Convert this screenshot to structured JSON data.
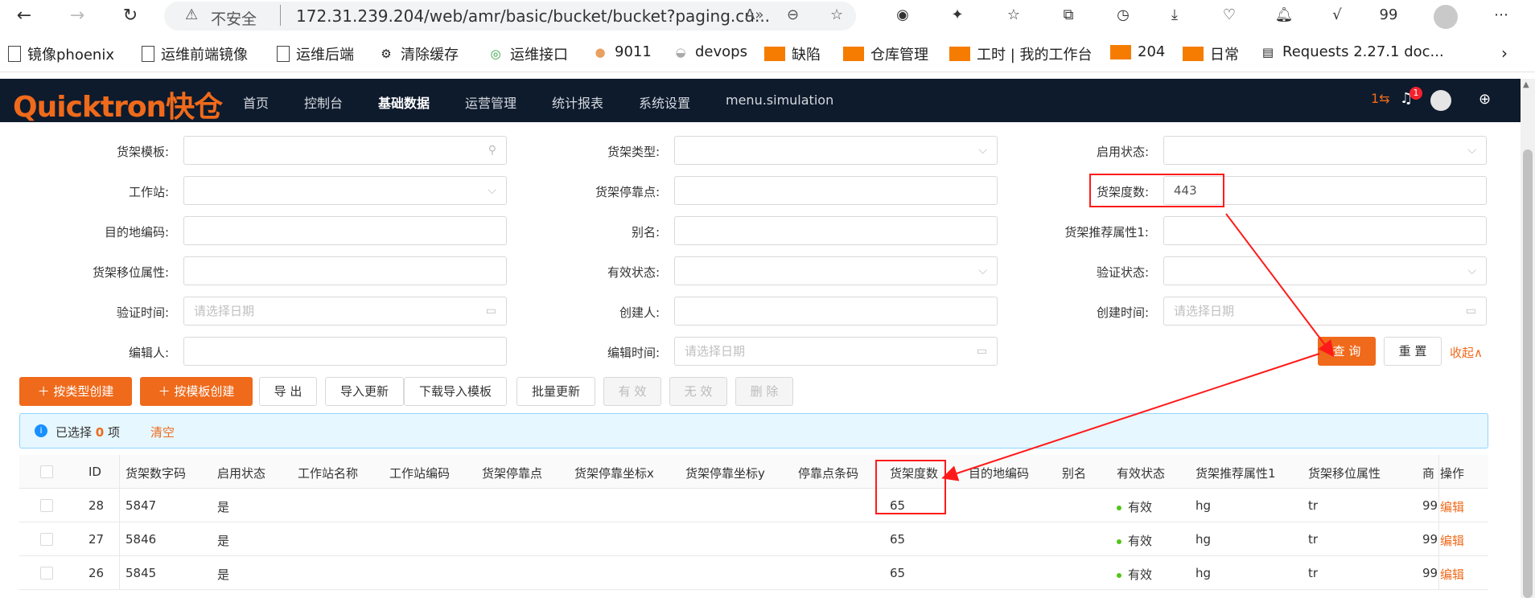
{
  "browser": {
    "insecure_label": "不安全",
    "url": "172.31.239.204/web/amr/basic/bucket/bucket?paging.cu...",
    "toolbar_extra": "99"
  },
  "bookmarks": [
    {
      "label": "镜像phoenix",
      "icon": "file-icon"
    },
    {
      "label": "运维前端镜像",
      "icon": "file-icon"
    },
    {
      "label": "运维后端",
      "icon": "file-icon"
    },
    {
      "label": "清除缓存",
      "icon": "gear-icon"
    },
    {
      "label": "运维接口",
      "icon": "api-icon"
    },
    {
      "label": "9011",
      "icon": "site-icon"
    },
    {
      "label": "devops",
      "icon": "site-icon"
    },
    {
      "label": "缺陷",
      "icon": "orange-icon"
    },
    {
      "label": "仓库管理",
      "icon": "orange-icon"
    },
    {
      "label": "工时 | 我的工作台",
      "icon": "orange-icon"
    },
    {
      "label": "204",
      "icon": "orange-icon"
    },
    {
      "label": "日常",
      "icon": "orange-icon"
    },
    {
      "label": "Requests 2.27.1 doc...",
      "icon": "doc-icon"
    }
  ],
  "app": {
    "logo": "Quicktron快仓",
    "menu": [
      "首页",
      "控制台",
      "基础数据",
      "运营管理",
      "统计报表",
      "系统设置",
      "menu.simulation"
    ],
    "active_menu": "基础数据",
    "header_count": "1⇆",
    "notification_badge": "1"
  },
  "form": {
    "bucket_template": {
      "label": "货架模板:",
      "value": ""
    },
    "bucket_type": {
      "label": "货架类型:",
      "value": ""
    },
    "enable_status": {
      "label": "启用状态:",
      "value": ""
    },
    "workstation": {
      "label": "工作站:",
      "value": ""
    },
    "stop_point": {
      "label": "货架停靠点:",
      "value": ""
    },
    "bucket_degree": {
      "label": "货架度数:",
      "value": "443"
    },
    "dest_code": {
      "label": "目的地编码:",
      "value": ""
    },
    "alias": {
      "label": "别名:",
      "value": ""
    },
    "recommend_attr": {
      "label": "货架推荐属性1:",
      "value": ""
    },
    "move_attr": {
      "label": "货架移位属性:",
      "value": ""
    },
    "valid_status": {
      "label": "有效状态:",
      "value": ""
    },
    "verify_status": {
      "label": "验证状态:",
      "value": ""
    },
    "verify_time": {
      "label": "验证时间:",
      "placeholder": "请选择日期"
    },
    "creator": {
      "label": "创建人:",
      "value": ""
    },
    "create_time": {
      "label": "创建时间:",
      "placeholder": "请选择日期"
    },
    "editor": {
      "label": "编辑人:",
      "value": ""
    },
    "edit_time": {
      "label": "编辑时间:",
      "placeholder": "请选择日期"
    },
    "query_button": "查 询",
    "reset_button": "重 置",
    "collapse_link": "收起∧"
  },
  "actions": {
    "create_by_type": "按类型创建",
    "create_by_template": "按模板创建",
    "export": "导 出",
    "import_update": "导入更新",
    "download_template": "下载导入模板",
    "batch_update": "批量更新",
    "valid": "有 效",
    "invalid": "无 效",
    "delete": "删 除"
  },
  "selection": {
    "prefix": "已选择",
    "count": "0",
    "suffix": "项",
    "clear": "清空"
  },
  "table": {
    "columns": [
      "ID",
      "货架数字码",
      "启用状态",
      "工作站名称",
      "工作站编码",
      "货架停靠点",
      "货架停靠坐标x",
      "货架停靠坐标y",
      "停靠点条码",
      "货架度数",
      "目的地编码",
      "别名",
      "有效状态",
      "货架推荐属性1",
      "货架移位属性",
      "商",
      "操作"
    ],
    "rows": [
      {
        "id": "28",
        "code": "5847",
        "enabled": "是",
        "degree": "65",
        "valid": "有效",
        "recommend": "hg",
        "move": "tr",
        "extra": "99",
        "action": "编辑"
      },
      {
        "id": "27",
        "code": "5846",
        "enabled": "是",
        "degree": "65",
        "valid": "有效",
        "recommend": "hg",
        "move": "tr",
        "extra": "99",
        "action": "编辑"
      },
      {
        "id": "26",
        "code": "5845",
        "enabled": "是",
        "degree": "65",
        "valid": "有效",
        "recommend": "hg",
        "move": "tr",
        "extra": "99",
        "action": "编辑"
      }
    ]
  },
  "colors": {
    "accent": "#ef6a1b",
    "header_bg": "#0e1b2d",
    "annotation": "#ff1a1a"
  }
}
